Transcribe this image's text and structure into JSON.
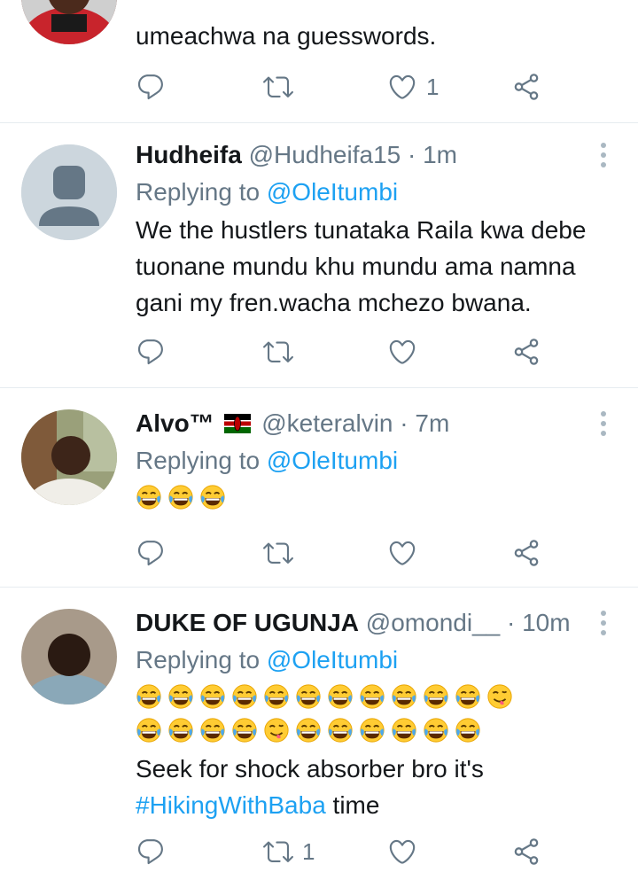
{
  "tweets": [
    {
      "text": "umeachwa na guesswords.",
      "actions": {
        "reply_count": "",
        "retweet_count": "",
        "like_count": "1"
      }
    },
    {
      "name": "Hudheifa",
      "handle": "@Hudheifa15",
      "dot": "·",
      "time": "1m",
      "replying_label": "Replying to",
      "replying_handle": "@OleItumbi",
      "text": "We the hustlers tunataka Raila kwa debe tuonane mundu khu mundu ama namna gani my fren.wacha mchezo bwana.",
      "actions": {
        "reply_count": "",
        "retweet_count": "",
        "like_count": ""
      }
    },
    {
      "name": "Alvo™",
      "flag": "kenya-flag",
      "handle": "@keteralvin",
      "dot": "·",
      "time": "7m",
      "replying_label": "Replying to",
      "replying_handle": "@OleItumbi",
      "emoji": [
        "😂",
        "😂",
        "😂"
      ],
      "actions": {
        "reply_count": "",
        "retweet_count": "",
        "like_count": ""
      }
    },
    {
      "name": "DUKE OF UGUNJA",
      "handle": "@omondi__",
      "dot": "·",
      "time": "10m",
      "replying_label": "Replying to",
      "replying_handle": "@OleItumbi",
      "emoji_line1": [
        "😂",
        "😂",
        "😂",
        "😂",
        "😂",
        "😂",
        "😂",
        "😂",
        "😂",
        "😂",
        "😂",
        "😋"
      ],
      "emoji_line2": [
        "😂",
        "😂",
        "😂",
        "😂",
        "😋",
        "😂",
        "😂",
        "😂",
        "😂",
        "😂",
        "😂"
      ],
      "text_before": "Seek for shock absorber bro it's",
      "hashtag": "#HikingWithBaba",
      "text_after": " time",
      "actions": {
        "reply_count": "",
        "retweet_count": "1",
        "like_count": ""
      }
    }
  ],
  "colors": {
    "accent": "#1da1f2",
    "secondary": "#657786",
    "divider": "#e6ecf0",
    "icon": "#657786"
  }
}
